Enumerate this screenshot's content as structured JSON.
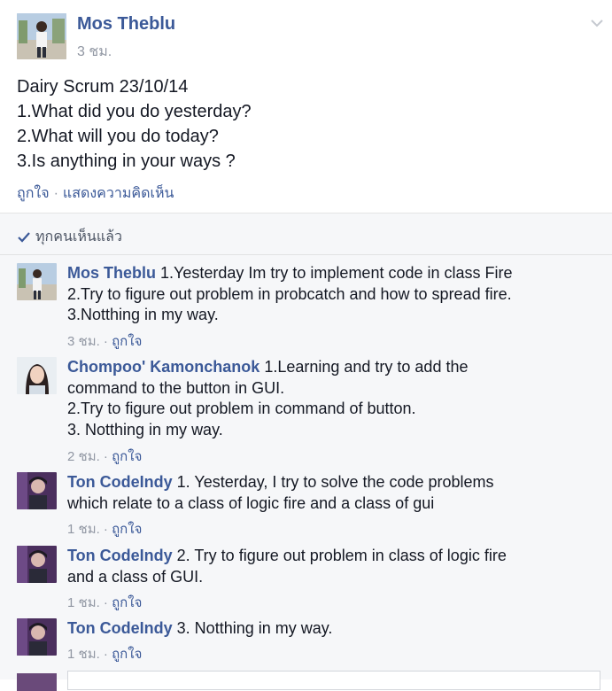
{
  "post": {
    "author": "Mos Theblu",
    "time": "3 ชม.",
    "lines": [
      "Dairy Scrum 23/10/14",
      "1.What did you do yesterday?",
      "2.What will you do today?",
      "3.Is anything in your ways ?"
    ],
    "like_label": "ถูกใจ",
    "separator": "·",
    "comment_label": "แสดงความคิดเห็น",
    "menu_icon": "chevron-down-icon"
  },
  "comments_section": {
    "seen_icon": "check-icon",
    "seen_label": "ทุกคนเห็นแล้ว"
  },
  "comments": [
    {
      "author": "Mos Theblu",
      "lines": [
        "1.Yesterday Im try to implement code in class Fire",
        "2.Try to figure out problem in probcatch and how to spread fire.",
        "3.Notthing in my way."
      ],
      "time": "3 ชม.",
      "separator": "·",
      "like": "ถูกใจ"
    },
    {
      "author": "Chompoo' Kamonchanok",
      "lines": [
        "1.Learning and try to add the",
        "command to the button in GUI.",
        "2.Try to figure out problem in command of button.",
        "3. Notthing in my way."
      ],
      "time": "2 ชม.",
      "separator": "·",
      "like": "ถูกใจ"
    },
    {
      "author": "Ton CodeIndy",
      "lines": [
        "1. Yesterday, I try to solve the code problems",
        "which relate to a class of logic fire and a class of gui"
      ],
      "time": "1 ชม.",
      "separator": "·",
      "like": "ถูกใจ"
    },
    {
      "author": "Ton CodeIndy",
      "lines": [
        "2. Try to figure out problem in class of logic fire",
        "and a class of GUI."
      ],
      "time": "1 ชม.",
      "separator": "·",
      "like": "ถูกใจ"
    },
    {
      "author": "Ton CodeIndy",
      "lines": [
        "3. Notthing in my way."
      ],
      "time": "1 ชม.",
      "separator": "·",
      "like": "ถูกใจ"
    }
  ],
  "colors": {
    "link_blue": "#3b5998",
    "meta_gray": "#9197a3",
    "text": "#141823",
    "comments_bg": "#f6f7f9"
  }
}
